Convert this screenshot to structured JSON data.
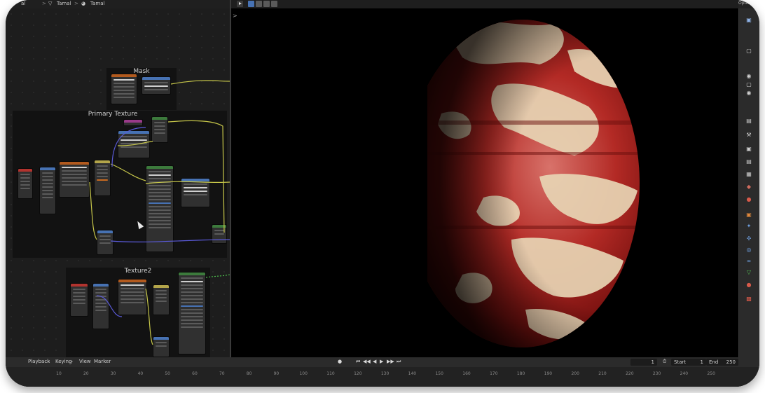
{
  "breadcrumb": {
    "items": [
      {
        "label": "al",
        "icon": "menu-icon"
      },
      {
        "label": "Tamal",
        "icon": "object-icon"
      },
      {
        "label": "Tamal",
        "icon": "material-icon"
      }
    ],
    "separator": ">"
  },
  "top_right_label": "Option",
  "node_frames": [
    {
      "label": "Mask"
    },
    {
      "label": "Primary Texture"
    },
    {
      "label": "Texture2"
    }
  ],
  "viewport": {
    "collapse_glyph": ">",
    "planet_colors": {
      "base": "#b32a25",
      "light": "#e8d5b5",
      "shadow": "#6a0e0c"
    }
  },
  "timeline": {
    "menus": [
      "Playback",
      "Keying",
      "View",
      "Marker"
    ],
    "current_frame": "1",
    "start_label": "Start",
    "start_value": "1",
    "end_label": "End",
    "end_value": "250",
    "ticks": [
      "10",
      "20",
      "30",
      "40",
      "50",
      "60",
      "70",
      "80",
      "90",
      "100",
      "110",
      "120",
      "130",
      "140",
      "150",
      "160",
      "170",
      "180",
      "190",
      "200",
      "210",
      "220",
      "230",
      "240",
      "250"
    ]
  },
  "properties_icons": [
    "tool-icon",
    "render-icon",
    "output-icon",
    "view-layer-icon",
    "scene-icon",
    "world-icon",
    "object-icon",
    "modifier-icon",
    "particles-icon",
    "physics-icon",
    "constraints-icon",
    "data-icon",
    "material-icon",
    "texture-icon"
  ],
  "colors": {
    "accent_blue": "#4772b3",
    "node_header_green": "#3c7a3c",
    "node_header_orange": "#b25a1e",
    "link_yellow": "#c8c84a",
    "link_blue": "#5a5ad8"
  }
}
